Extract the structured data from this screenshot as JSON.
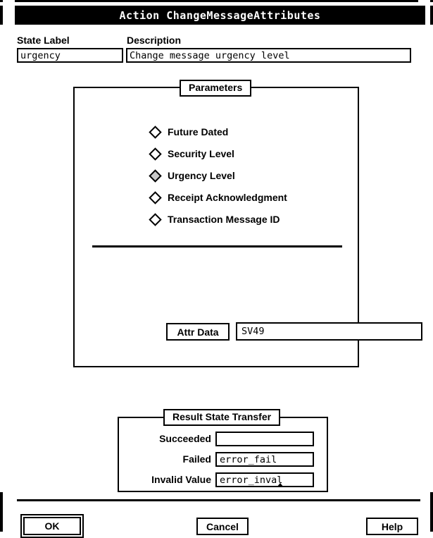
{
  "window": {
    "title": "Action ChangeMessageAttributes"
  },
  "top_fields": {
    "state_label": {
      "label": "State Label",
      "value": "urgency",
      "placeholder": ""
    },
    "description": {
      "label": "Description",
      "value": "Change message urgency level",
      "placeholder": ""
    }
  },
  "parameters": {
    "title": "Parameters",
    "options": [
      {
        "label": "Future Dated",
        "selected": false
      },
      {
        "label": "Security Level",
        "selected": false
      },
      {
        "label": "Urgency Level",
        "selected": true
      },
      {
        "label": "Receipt Acknowledgment",
        "selected": false
      },
      {
        "label": "Transaction Message ID",
        "selected": false
      }
    ],
    "attr_data": {
      "button_label": "Attr Data",
      "value": "SV49",
      "placeholder": ""
    }
  },
  "result_state_transfer": {
    "title": "Result State Transfer",
    "rows": [
      {
        "label": "Succeeded",
        "value": "",
        "caret": false
      },
      {
        "label": "Failed",
        "value": "error_fail",
        "caret": false
      },
      {
        "label": "Invalid Value",
        "value": "error_inval",
        "caret": true
      }
    ]
  },
  "actions": {
    "ok_label": "OK",
    "cancel_label": "Cancel",
    "help_label": "Help"
  },
  "colors": {
    "background": "#ffffff",
    "foreground": "#000000",
    "titlebar_bg": "#000000",
    "titlebar_fg": "#ffffff",
    "selected_diamond": "#c8c8c8"
  }
}
